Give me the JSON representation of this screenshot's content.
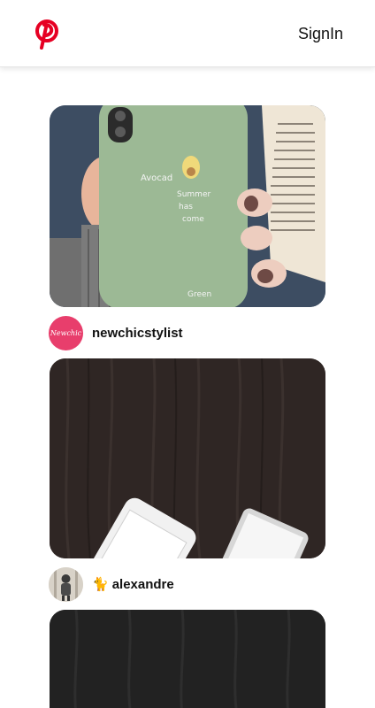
{
  "header": {
    "logo_icon": "pinterest-logo-icon",
    "brand_color": "#e60023",
    "signin_label": "SignIn"
  },
  "feed": {
    "pins": [
      {
        "image_icon": "phone-case-avocado-photo",
        "case_text": [
          "Avocad",
          "Summer",
          "has",
          "come",
          "Green"
        ],
        "author": {
          "name": "newchicstylist",
          "avatar_text": "Newchic",
          "avatar_color": "#e83e6c"
        }
      },
      {
        "image_icon": "phones-on-wood-photo",
        "author": {
          "name": "alexandre",
          "prefix_icon": "cat-icon",
          "prefix_glyph": "🐈"
        }
      },
      {
        "image_icon": "dark-wood-photo"
      }
    ]
  }
}
